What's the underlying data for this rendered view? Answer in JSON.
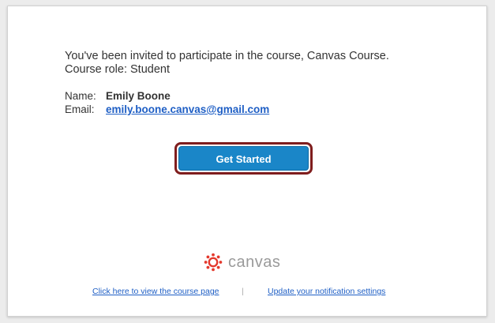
{
  "message": {
    "line1": "You've been invited to participate in the course, Canvas Course.",
    "line2": "Course role: Student"
  },
  "details": {
    "name_label": "Name:",
    "name_value": "Emily Boone",
    "email_label": "Email:",
    "email_value": "emily.boone.canvas@gmail.com"
  },
  "cta": {
    "label": "Get Started"
  },
  "logo": {
    "wordmark": "canvas",
    "icon": "canvas-logo-icon"
  },
  "footer": {
    "course_link": "Click here to view the course page",
    "separator": "|",
    "notification_link": "Update your notification settings"
  },
  "colors": {
    "button": "#1a86c8",
    "highlight_ring": "#7f1d1d",
    "link": "#1f5fc5",
    "logo_red": "#e4392d"
  }
}
